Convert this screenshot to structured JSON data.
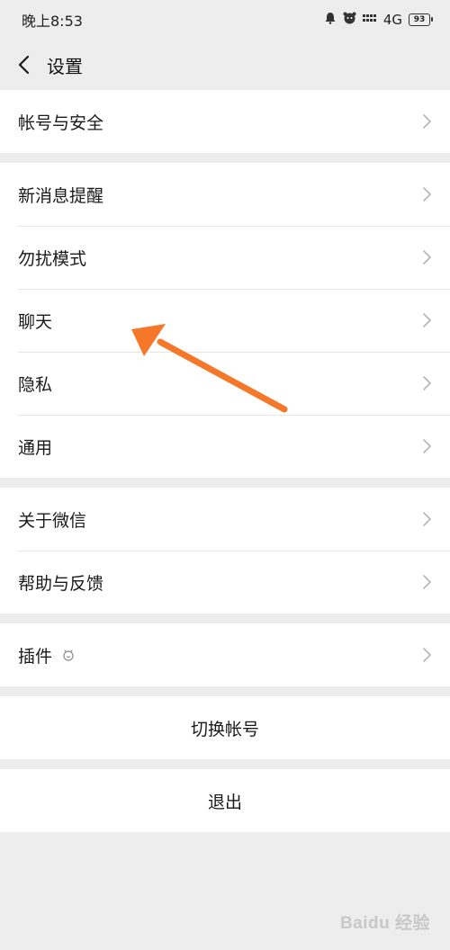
{
  "status_bar": {
    "time": "晚上8:53",
    "network": "4G",
    "battery": "93",
    "icons": [
      "bell-icon",
      "face-icon",
      "signal-icon"
    ]
  },
  "nav": {
    "title": "设置",
    "back_icon": "chevron-left-icon"
  },
  "groups": [
    {
      "items": [
        {
          "label": "帐号与安全"
        }
      ]
    },
    {
      "items": [
        {
          "label": "新消息提醒"
        },
        {
          "label": "勿扰模式"
        },
        {
          "label": "聊天"
        },
        {
          "label": "隐私"
        },
        {
          "label": "通用"
        }
      ]
    },
    {
      "items": [
        {
          "label": "关于微信"
        },
        {
          "label": "帮助与反馈"
        }
      ]
    },
    {
      "items": [
        {
          "label": "插件",
          "icon": "plugin-icon"
        }
      ]
    }
  ],
  "actions": {
    "switch_account": "切换帐号",
    "logout": "退出"
  },
  "annotation": {
    "arrow_color": "#f5782a"
  },
  "watermark": "Baidu 经验"
}
